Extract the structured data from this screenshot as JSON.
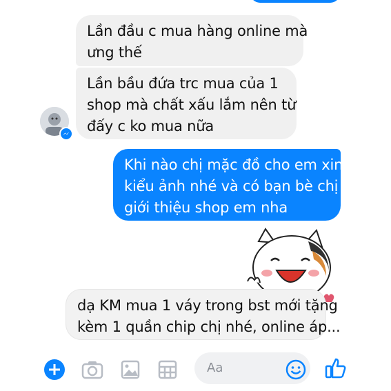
{
  "messages": [
    {
      "id": "top-out",
      "side": "out",
      "lines": []
    },
    {
      "id": "msg1",
      "side": "in",
      "lines": [
        "Lần đầu c mua hàng online mà",
        "ưng thế"
      ]
    },
    {
      "id": "msg2",
      "side": "in",
      "lines": [
        "Lần bầu đứa trc mua của 1",
        "shop mà chất xấu lắm nên từ",
        "đấy c ko mua nữa"
      ]
    },
    {
      "id": "msg3",
      "side": "out",
      "lines": [
        "Khi nào chị mặc đồ cho em xin",
        "kiểu ảnh nhé và có bạn bè chị",
        "giới thiệu shop em nha"
      ]
    },
    {
      "id": "msg4",
      "side": "out-light",
      "lines": [
        "dạ KM mua 1 váy trong bst mới tặng",
        "kèm 1 quần chip chị nhé, online áp..."
      ]
    }
  ],
  "composer": {
    "placeholder": "Aa"
  },
  "icons": {
    "plus": "plus-icon",
    "camera": "camera-icon",
    "image": "image-icon",
    "sticker_grid": "grid-icon",
    "emoji": "smile-icon",
    "like": "thumbs-up-icon"
  },
  "colors": {
    "outgoing": "#0a84ff",
    "incoming": "#f0f0f0",
    "accent": "#0a84ff"
  }
}
